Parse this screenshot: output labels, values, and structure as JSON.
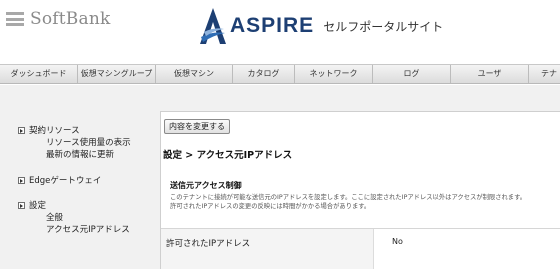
{
  "brand": {
    "softbank": "SoftBank",
    "aspire": "ASPIRE",
    "portal": "セルフポータルサイト"
  },
  "nav": {
    "items": [
      {
        "label": "ダッシュボード"
      },
      {
        "label": "仮想マシングループ"
      },
      {
        "label": "仮想マシン"
      },
      {
        "label": "カタログ"
      },
      {
        "label": "ネットワーク"
      },
      {
        "label": "ログ"
      },
      {
        "label": "ユーザ"
      },
      {
        "label": "テナ"
      }
    ]
  },
  "sidebar": {
    "sections": [
      {
        "label": "契約リソース",
        "links": [
          "リソース使用量の表示",
          "最新の情報に更新"
        ]
      },
      {
        "label": "Edgeゲートウェイ",
        "links": []
      },
      {
        "label": "設定",
        "links": [
          "全般",
          "アクセス元IPアドレス"
        ]
      }
    ]
  },
  "main": {
    "change_button": "内容を変更する",
    "title": "設定 > アクセス元IPアドレス",
    "section_title": "送信元アクセス制御",
    "description_line1": "このテナントに接続が可能な送信元のIPアドレスを設定します。ここに設定されたIPアドレス以外はアクセスが制限されます。",
    "description_line2": "許可されたIPアドレスの変更の反映には時間がかかる場合があります。",
    "field_label": "許可されたIPアドレス",
    "field_value": "No"
  },
  "colors": {
    "brand_navy": "#1d3f73",
    "brand_blue": "#2f6db5",
    "softbank_gray": "#8a8a8a"
  }
}
